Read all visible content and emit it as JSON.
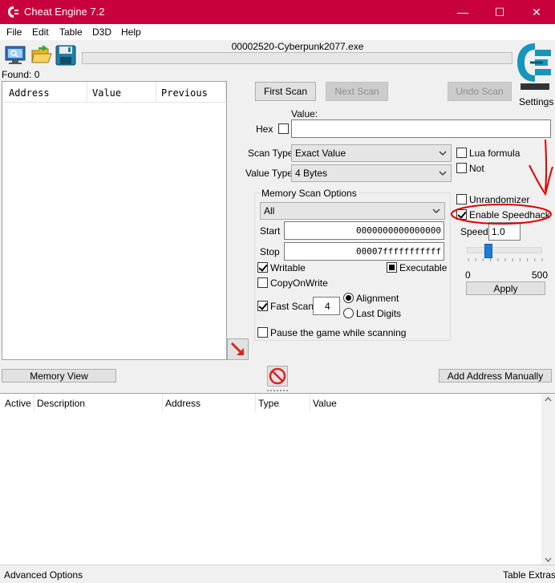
{
  "window": {
    "title": "Cheat Engine 7.2"
  },
  "menu": [
    "File",
    "Edit",
    "Table",
    "D3D",
    "Help"
  ],
  "toolbar": {
    "process": "00002520-Cyberpunk2077.exe"
  },
  "found": "Found: 0",
  "results": {
    "columns": [
      "Address",
      "Value",
      "Previous"
    ]
  },
  "scan": {
    "first": "First Scan",
    "next": "Next Scan",
    "undo": "Undo Scan",
    "value_label": "Value:",
    "hex_label": "Hex",
    "value": "",
    "scan_type_label": "Scan Type",
    "scan_type": "Exact Value",
    "value_type_label": "Value Type",
    "value_type": "4 Bytes",
    "lua_formula": "Lua formula",
    "not": "Not"
  },
  "memory": {
    "title": "Memory Scan Options",
    "region": "All",
    "start_label": "Start",
    "start": "0000000000000000",
    "stop_label": "Stop",
    "stop": "00007fffffffffff",
    "writable": "Writable",
    "executable": "Executable",
    "copyonwrite": "CopyOnWrite",
    "fast_scan": "Fast Scan",
    "fast_value": "4",
    "alignment": "Alignment",
    "last_digits": "Last Digits",
    "pause": "Pause the game while scanning"
  },
  "speedhack": {
    "settings": "Settings",
    "unrandomizer": "Unrandomizer",
    "enable": "Enable Speedhack",
    "speed_label": "Speed",
    "speed": "1.0",
    "min": "0",
    "max": "500",
    "apply": "Apply",
    "slider_fraction": 0.002
  },
  "buttons": {
    "memory_view": "Memory View",
    "add_manual": "Add Address Manually"
  },
  "addresses": {
    "columns": [
      "Active",
      "Description",
      "Address",
      "Type",
      "Value"
    ]
  },
  "status": {
    "left": "Advanced Options",
    "right": "Table Extras"
  },
  "colors": {
    "titlebar": "#c8003c",
    "annotation": "#e00000",
    "slider": "#1e7bd4"
  }
}
